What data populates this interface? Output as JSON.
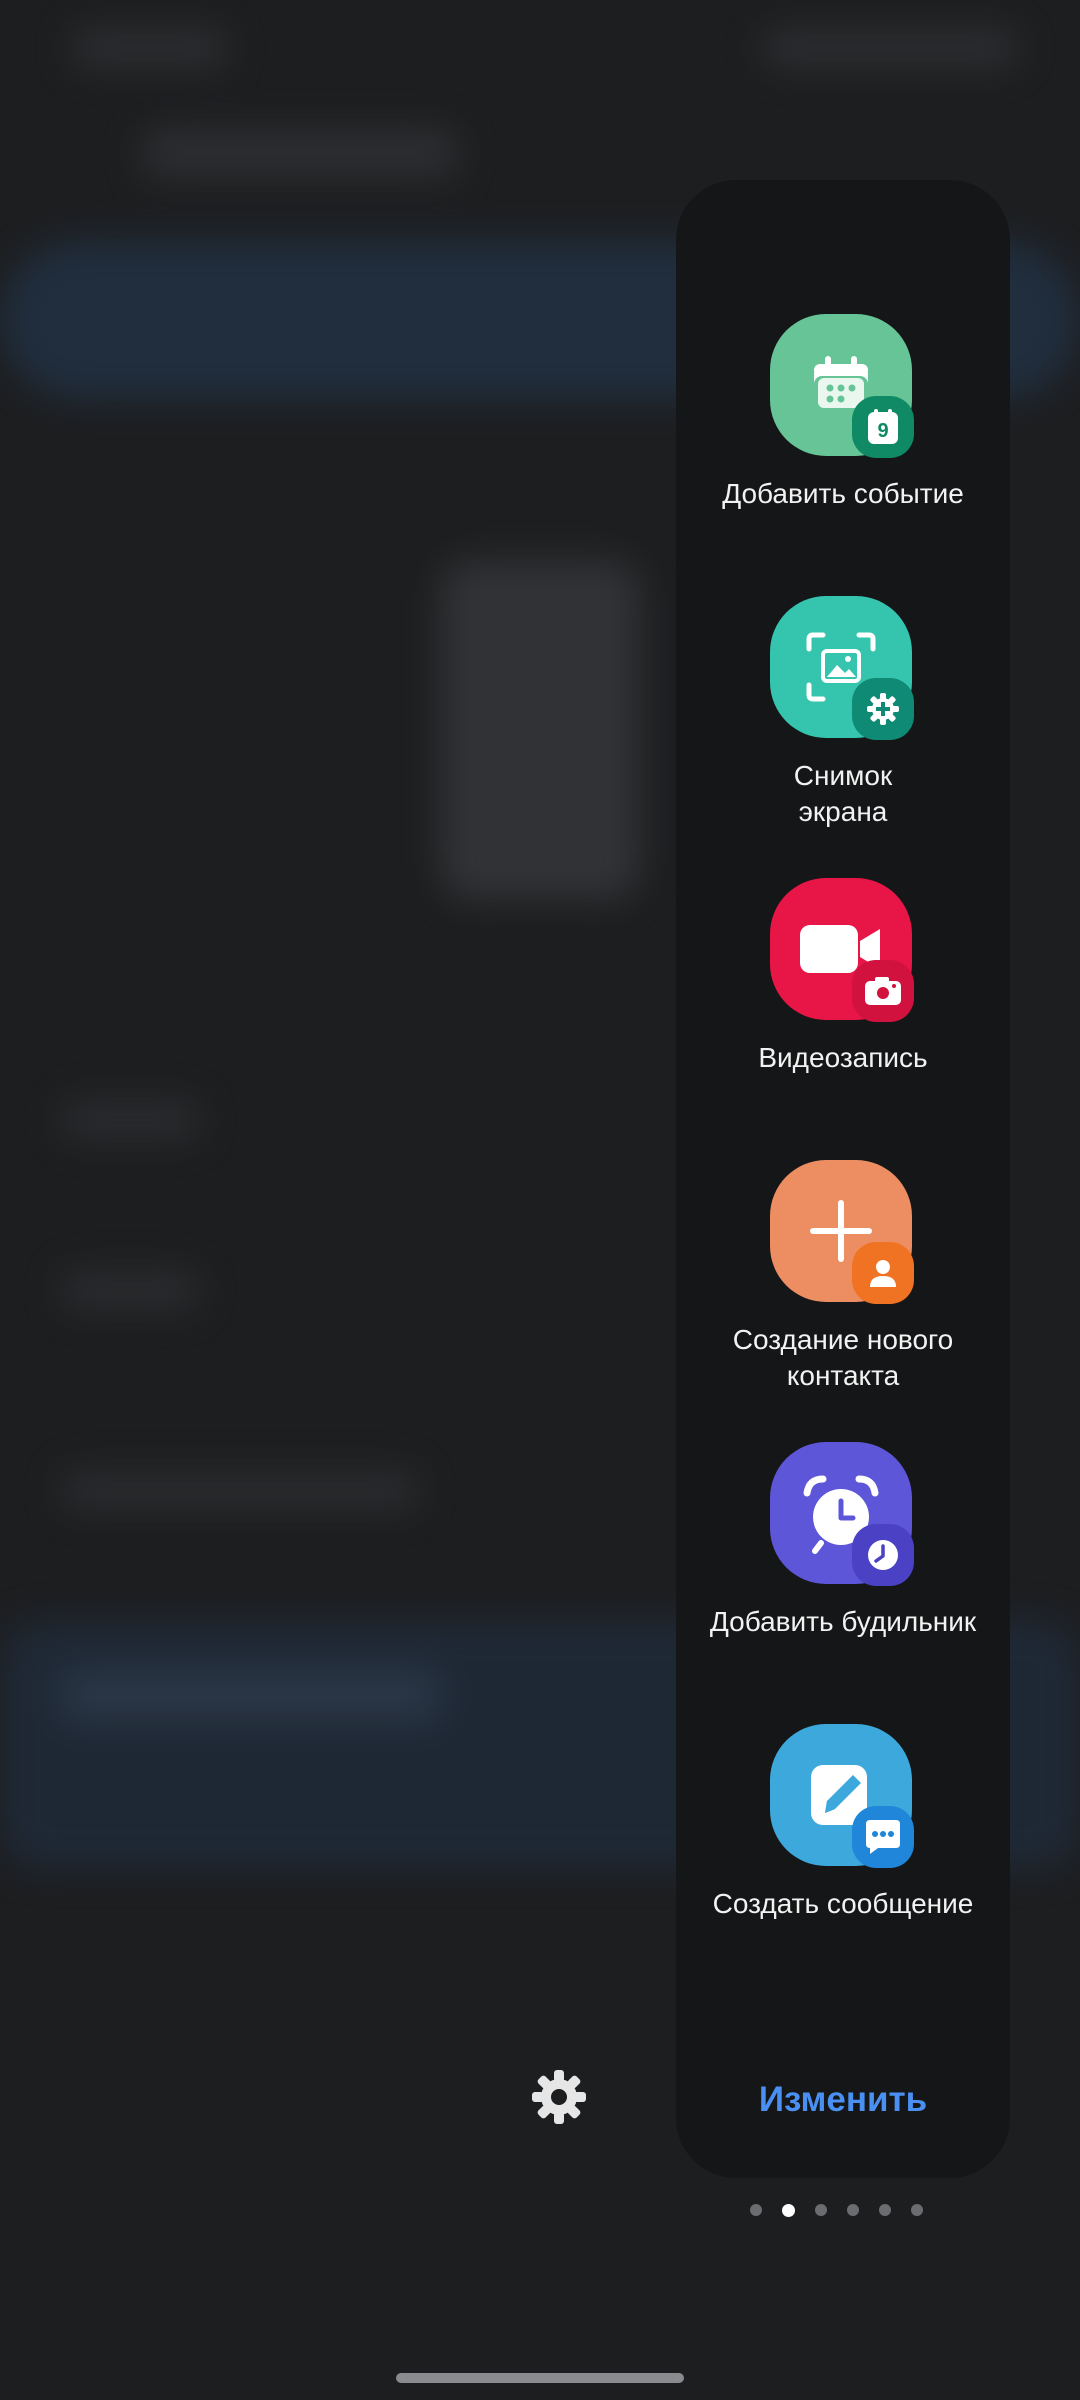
{
  "edge_panel": {
    "shortcuts": [
      {
        "label": "Добавить событие",
        "icon": "calendar-icon",
        "badge": "calendar-9-icon",
        "color": "#5cbf8e",
        "badge_color": "#0f8a64",
        "badge_text": "9"
      },
      {
        "label": "Снимок\nэкрана",
        "icon": "screenshot-icon",
        "badge": "gear-icon",
        "color": "#35c4ae",
        "badge_color": "#0f8a74"
      },
      {
        "label": "Видеозапись",
        "icon": "video-camera-icon",
        "badge": "camera-icon",
        "color": "#e81547",
        "badge_color": "#d1123f"
      },
      {
        "label": "Создание нового\nконтакта",
        "icon": "plus-icon",
        "badge": "person-icon",
        "color": "#ec8e62",
        "badge_color": "#f07323"
      },
      {
        "label": "Добавить будильник",
        "icon": "alarm-clock-icon",
        "badge": "clock-icon",
        "color": "#5e56d8",
        "badge_color": "#4a41c5"
      },
      {
        "label": "Создать сообщение",
        "icon": "edit-message-icon",
        "badge": "chat-bubble-icon",
        "color": "#3ca8db",
        "badge_color": "#1f86d9"
      }
    ],
    "edit_label": "Изменить",
    "accent_color": "#4a8ff2"
  },
  "page_indicator": {
    "total": 6,
    "active_index": 1
  }
}
